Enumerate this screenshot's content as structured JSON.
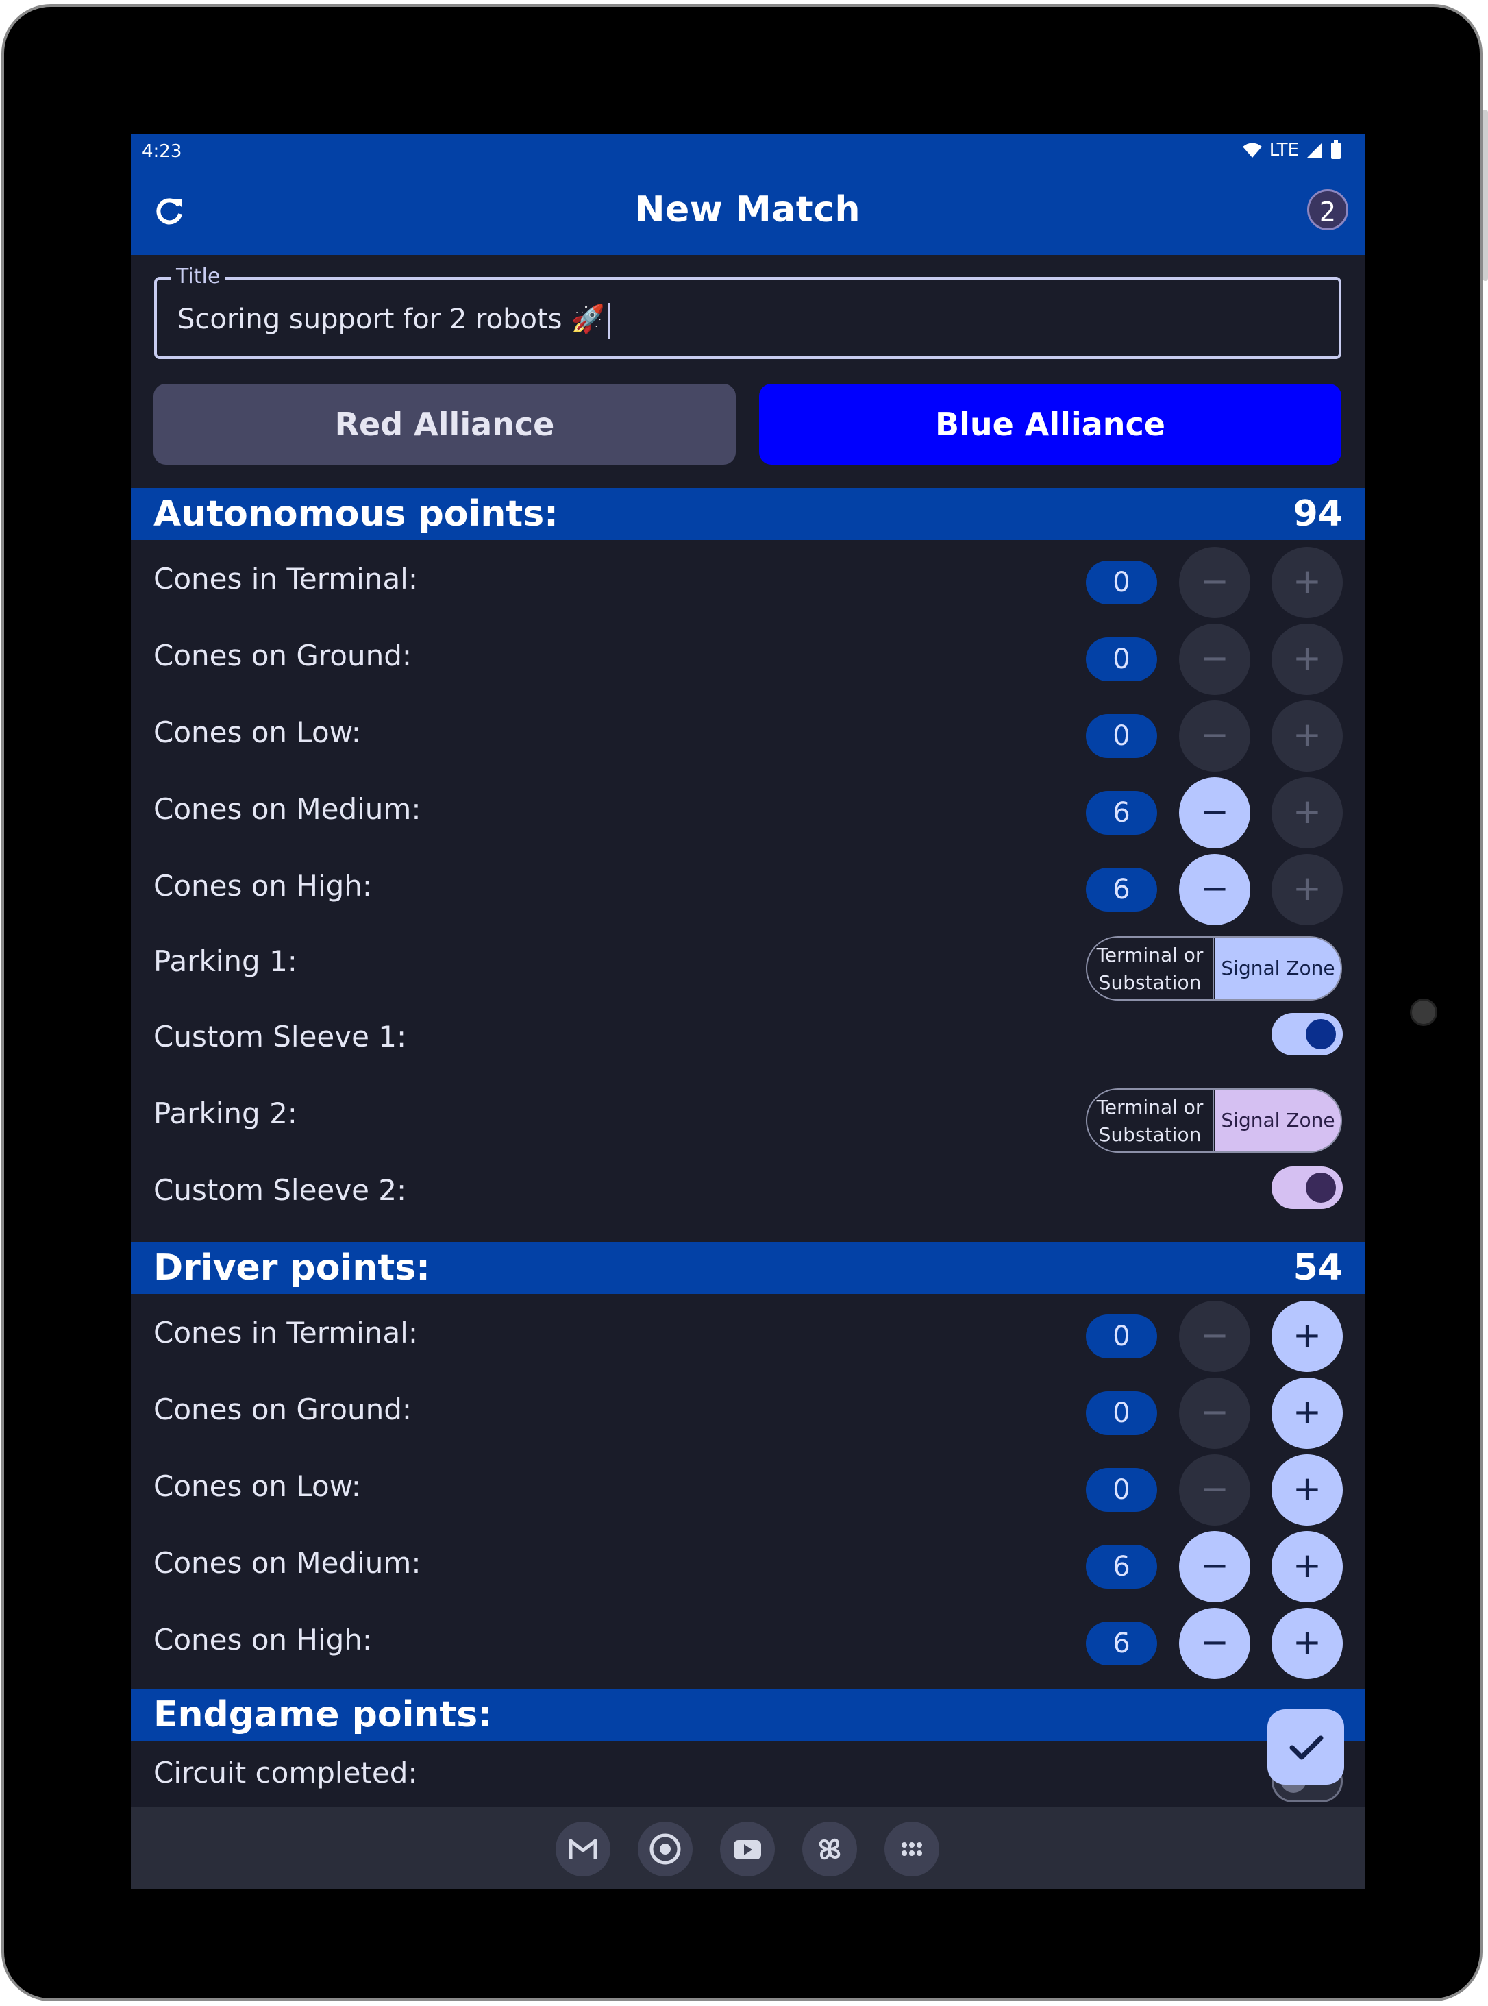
{
  "status": {
    "time": "4:23",
    "network": "LTE"
  },
  "appbar": {
    "title": "New Match",
    "badge": "2"
  },
  "title_field": {
    "label": "Title",
    "value": "Scoring support for 2 robots 🚀"
  },
  "alliances": {
    "red": "Red Alliance",
    "blue": "Blue Alliance"
  },
  "autonomous": {
    "title": "Autonomous points:",
    "score": "94",
    "rows": [
      {
        "label": "Cones in Terminal:",
        "value": "0"
      },
      {
        "label": "Cones on Ground:",
        "value": "0"
      },
      {
        "label": "Cones on Low:",
        "value": "0"
      },
      {
        "label": "Cones on Medium:",
        "value": "6"
      },
      {
        "label": "Cones on High:",
        "value": "6"
      }
    ],
    "parking1": {
      "label": "Parking 1:",
      "option_a_line1": "Terminal or",
      "option_a_line2": "Substation",
      "option_b": "Signal Zone"
    },
    "sleeve1": {
      "label": "Custom Sleeve 1:"
    },
    "parking2": {
      "label": "Parking 2:",
      "option_a_line1": "Terminal or",
      "option_a_line2": "Substation",
      "option_b": "Signal Zone"
    },
    "sleeve2": {
      "label": "Custom Sleeve 2:"
    }
  },
  "driver": {
    "title": "Driver points:",
    "score": "54",
    "rows": [
      {
        "label": "Cones in Terminal:",
        "value": "0"
      },
      {
        "label": "Cones on Ground:",
        "value": "0"
      },
      {
        "label": "Cones on Low:",
        "value": "0"
      },
      {
        "label": "Cones on Medium:",
        "value": "6"
      },
      {
        "label": "Cones on High:",
        "value": "6"
      }
    ]
  },
  "endgame": {
    "title": "Endgame points:",
    "circuit_label": "Circuit completed:"
  },
  "buttons": {
    "minus": "−",
    "plus": "+"
  },
  "taskbar": [
    "gmail-icon",
    "chrome-icon",
    "youtube-icon",
    "pinwheel-icon",
    "app-drawer-icon"
  ],
  "colors": {
    "primary": "#0341a6",
    "background": "#1a1c29",
    "blue_alliance": "#0000fe",
    "accent": "#b6c6ff"
  }
}
